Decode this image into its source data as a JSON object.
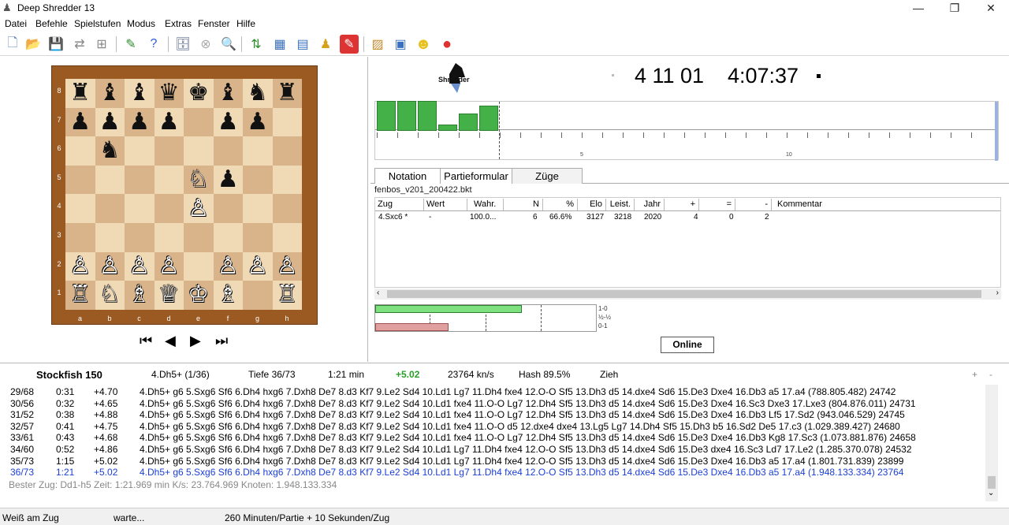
{
  "window": {
    "title": "Deep Shredder 13",
    "minimize": "—",
    "maximize": "❐",
    "close": "✕"
  },
  "menu": [
    "Datei",
    "Befehle",
    "Spielstufen",
    "Modus",
    "Extras",
    "Fenster",
    "Hilfe"
  ],
  "board": {
    "rows": [
      [
        "♜",
        "♝",
        "♝",
        "♛",
        "♚",
        "♝",
        "♞",
        "♜"
      ],
      [
        "♟",
        "♟",
        "♟",
        "♟",
        "",
        "♟",
        "♟",
        ""
      ],
      [
        "",
        "♞",
        "",
        "",
        "",
        "",
        "",
        ""
      ],
      [
        "",
        "",
        "",
        "",
        "♘",
        "♟",
        "",
        ""
      ],
      [
        "",
        "",
        "",
        "",
        "♙",
        "",
        "",
        ""
      ],
      [
        "",
        "",
        "",
        "",
        "",
        "",
        "",
        ""
      ],
      [
        "♙",
        "♙",
        "♙",
        "♙",
        "",
        "♙",
        "♙",
        "♙"
      ],
      [
        "♖",
        "♘",
        "♗",
        "♕",
        "♔",
        "♗",
        "",
        "♖"
      ]
    ],
    "ranks": [
      "8",
      "7",
      "6",
      "5",
      "4",
      "3",
      "2",
      "1"
    ],
    "files": [
      "a",
      "b",
      "c",
      "d",
      "e",
      "f",
      "g",
      "h"
    ]
  },
  "nav": {
    "first": "⏮",
    "prev": "◀",
    "next": "▶",
    "last": "⏭"
  },
  "clocks": {
    "white": "4 11 01",
    "black": "4:07:37"
  },
  "logo_label": "Shredder",
  "graph": {
    "bars": [
      45,
      45,
      45,
      8,
      22,
      32
    ],
    "ticks": [
      "5",
      "10"
    ]
  },
  "tabs": [
    "Notation",
    "Partieformular",
    "Züge"
  ],
  "book_file": "fenbos_v201_200422.bkt",
  "moves_table": {
    "headers": [
      "Zug",
      "Wert",
      "Wahr.",
      "N",
      "%",
      "Elo",
      "Leist.",
      "Jahr",
      "+",
      "=",
      "-",
      "Kommentar"
    ],
    "rows": [
      [
        "4.Sxc6 *",
        "-",
        "100.0...",
        "6",
        "66.6%",
        "3127",
        "3218",
        "2020",
        "4",
        "0",
        "2",
        ""
      ]
    ]
  },
  "stats": {
    "labels": [
      "1-0",
      "½-½",
      "0-1"
    ],
    "white_pct": 0.66,
    "draw_pct": 0.0,
    "black_pct": 0.33
  },
  "online_button": "Online",
  "engine": {
    "name": "Stockfish 150",
    "best": "4.Dh5+ (1/36)",
    "depth": "Tiefe 36/73",
    "time": "1:21 min",
    "score": "+5.02",
    "speed": "23764 kn/s",
    "hash": "Hash 89.5%",
    "status": "Zieh",
    "plus": "+",
    "minus": "-"
  },
  "lines": [
    {
      "depth": "29/68",
      "time": "0:31",
      "score": "+4.70",
      "pv": "4.Dh5+ g6 5.Sxg6 Sf6 6.Dh4 hxg6 7.Dxh8 De7 8.d3 Kf7 9.Le2 Sd4 10.Ld1 Lg7 11.Dh4 fxe4 12.O-O Sf5 13.Dh3 d5 14.dxe4 Sd6 15.De3 Dxe4 16.Db3 a5 17.a4 (788.805.482) 24742"
    },
    {
      "depth": "30/56",
      "time": "0:32",
      "score": "+4.65",
      "pv": "4.Dh5+ g6 5.Sxg6 Sf6 6.Dh4 hxg6 7.Dxh8 De7 8.d3 Kf7 9.Le2 Sd4 10.Ld1 fxe4 11.O-O Lg7 12.Dh4 Sf5 13.Dh3 d5 14.dxe4 Sd6 15.De3 Dxe4 16.Sc3 Dxe3 17.Lxe3 (804.876.011) 24731"
    },
    {
      "depth": "31/52",
      "time": "0:38",
      "score": "+4.88",
      "pv": "4.Dh5+ g6 5.Sxg6 Sf6 6.Dh4 hxg6 7.Dxh8 De7 8.d3 Kf7 9.Le2 Sd4 10.Ld1 fxe4 11.O-O Lg7 12.Dh4 Sf5 13.Dh3 d5 14.dxe4 Sd6 15.De3 Dxe4 16.Db3 Lf5 17.Sd2 (943.046.529) 24745"
    },
    {
      "depth": "32/57",
      "time": "0:41",
      "score": "+4.75",
      "pv": "4.Dh5+ g6 5.Sxg6 Sf6 6.Dh4 hxg6 7.Dxh8 De7 8.d3 Kf7 9.Le2 Sd4 10.Ld1 fxe4 11.O-O d5 12.dxe4 dxe4 13.Lg5 Lg7 14.Dh4 Sf5 15.Dh3 b5 16.Sd2 De5 17.c3 (1.029.389.427) 24680"
    },
    {
      "depth": "33/61",
      "time": "0:43",
      "score": "+4.68",
      "pv": "4.Dh5+ g6 5.Sxg6 Sf6 6.Dh4 hxg6 7.Dxh8 De7 8.d3 Kf7 9.Le2 Sd4 10.Ld1 fxe4 11.O-O Lg7 12.Dh4 Sf5 13.Dh3 d5 14.dxe4 Sd6 15.De3 Dxe4 16.Db3 Kg8 17.Sc3 (1.073.881.876) 24658"
    },
    {
      "depth": "34/60",
      "time": "0:52",
      "score": "+4.86",
      "pv": "4.Dh5+ g6 5.Sxg6 Sf6 6.Dh4 hxg6 7.Dxh8 De7 8.d3 Kf7 9.Le2 Sd4 10.Ld1 Lg7 11.Dh4 fxe4 12.O-O Sf5 13.Dh3 d5 14.dxe4 Sd6 15.De3 dxe4 16.Sc3 Ld7 17.Le2 (1.285.370.078) 24532"
    },
    {
      "depth": "35/73",
      "time": "1:15",
      "score": "+5.02",
      "pv": "4.Dh5+ g6 5.Sxg6 Sf6 6.Dh4 hxg6 7.Dxh8 De7 8.d3 Kf7 9.Le2 Sd4 10.Ld1 Lg7 11.Dh4 fxe4 12.O-O Sf5 13.Dh3 d5 14.dxe4 Sd6 15.De3 Dxe4 16.Db3 a5 17.a4 (1.801.731.839) 23899"
    },
    {
      "depth": "36/73",
      "time": "1:21",
      "score": "+5.02",
      "pv": "4.Dh5+ g6 5.Sxg6 Sf6 6.Dh4 hxg6 7.Dxh8 De7 8.d3 Kf7 9.Le2 Sd4 10.Ld1 Lg7 11.Dh4 fxe4 12.O-O Sf5 13.Dh3 d5 14.dxe4 Sd6 15.De3 Dxe4 16.Db3 a5 17.a4 (1.948.133.334) 23764"
    }
  ],
  "best_line": "Bester Zug: Dd1-h5 Zeit: 1:21.969 min  K/s: 23.764.969  Knoten: 1.948.133.334",
  "status": {
    "turn": "Weiß am Zug",
    "state": "warte...",
    "time_control": "260 Minuten/Partie + 10 Sekunden/Zug"
  },
  "colors": {
    "accent_blue": "#1a3fd6",
    "score_green": "#2aa02a",
    "graph_green": "#43b048",
    "loss_red": "#e0a0a0"
  }
}
